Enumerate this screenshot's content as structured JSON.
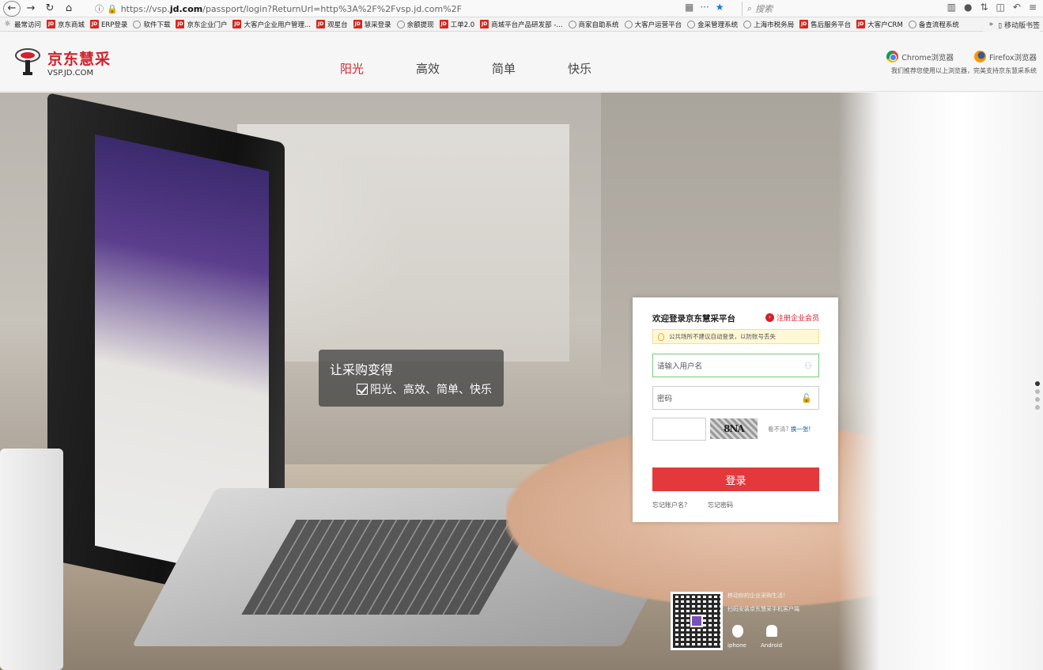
{
  "browser": {
    "url_prefix": "https://vsp.",
    "url_host": "jd.com",
    "url_rest": "/passport/login?ReturnUrl=http%3A%2F%2Fvsp.jd.com%2F",
    "search_placeholder": "搜索",
    "more_label": "···"
  },
  "bookmarks": [
    {
      "label": "最常访问",
      "icon": "gear-icon"
    },
    {
      "label": "京东商城",
      "icon": "jd-icon"
    },
    {
      "label": "ERP登录",
      "icon": "jd-icon"
    },
    {
      "label": "软件下载",
      "icon": "globe-icon"
    },
    {
      "label": "京东企业门户",
      "icon": "jd-icon"
    },
    {
      "label": "大客户企业用户管理...",
      "icon": "jd-icon"
    },
    {
      "label": "观星台",
      "icon": "jd-icon"
    },
    {
      "label": "慧采登录",
      "icon": "jd-icon"
    },
    {
      "label": "余额提现",
      "icon": "globe-icon"
    },
    {
      "label": "工单2.0",
      "icon": "jd-icon"
    },
    {
      "label": "商城平台产品研发部 -...",
      "icon": "jd-icon"
    },
    {
      "label": "商家自助系统",
      "icon": "globe-icon"
    },
    {
      "label": "大客户运营平台",
      "icon": "globe-icon"
    },
    {
      "label": "金采管理系统",
      "icon": "globe-icon"
    },
    {
      "label": "上海市税务局",
      "icon": "globe-icon"
    },
    {
      "label": "售后服务平台",
      "icon": "jd-icon"
    },
    {
      "label": "大客户CRM",
      "icon": "jd-icon"
    },
    {
      "label": "备查流程系统",
      "icon": "globe-icon"
    }
  ],
  "bookmarks_overflow": "»",
  "mobile_bookmarks": "移动版书签",
  "header": {
    "logo_title": "京东慧采",
    "logo_sub": "VSP.JD.COM",
    "nav": [
      "阳光",
      "高效",
      "简单",
      "快乐"
    ],
    "chrome_label": "Chrome浏览器",
    "firefox_label": "Firefox浏览器",
    "browser_note": "我们推荐您使用以上浏览器，完美支持京东慧采系统"
  },
  "hero": {
    "slogan_title": "让采购变得",
    "slogan_sub": "阳光、高效、简单、快乐"
  },
  "login": {
    "title": "欢迎登录京东慧采平台",
    "register": "注册企业会员",
    "notice": "公共场所不建议自动登录，以防账号丢失",
    "username_placeholder": "请输入用户名",
    "password_placeholder": "密码",
    "captcha_text": "8NA",
    "captcha_hint": "看不清?",
    "captcha_refresh": "换一张!",
    "submit": "登录",
    "forgot_user": "忘记账户名？",
    "forgot_pass": "忘记密码"
  },
  "app_promo": {
    "line1": "移动你的企业采购生活！",
    "line2": "扫码安装京东慧采手机客户端",
    "ios": "iphone",
    "android": "Android"
  },
  "colors": {
    "brand": "#d2222a",
    "login_button": "#e4393c"
  }
}
